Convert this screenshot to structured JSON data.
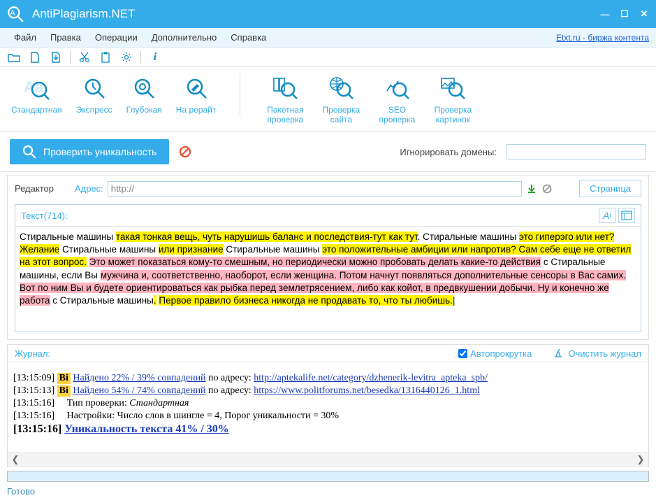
{
  "app": {
    "title": "AntiPlagiarism.NET"
  },
  "menu": {
    "items": [
      "Файл",
      "Правка",
      "Операции",
      "Дополнительно",
      "Справка"
    ],
    "right_link": "Etxt.ru - биржа контента"
  },
  "ribbon": {
    "left": [
      {
        "label": "Стандартная"
      },
      {
        "label": "Экспресс"
      },
      {
        "label": "Глубокая"
      },
      {
        "label": "На рерайт"
      }
    ],
    "right": [
      {
        "label": "Пакетная проверка"
      },
      {
        "label": "Проверка сайта"
      },
      {
        "label": "SEO проверка"
      },
      {
        "label": "Проверка картинок"
      }
    ]
  },
  "action": {
    "check_btn": "Проверить уникальность",
    "ignore_label": "Игнорировать домены:",
    "ignore_value": ""
  },
  "editor": {
    "label": "Редактор",
    "address_label": "Адрес:",
    "address_value": "http://",
    "page_tab": "Страница",
    "text_label": "Текст(714):",
    "segments": [
      {
        "text": "Стиральные машины ",
        "cls": ""
      },
      {
        "text": "такая тонкая вещь, чуть нарушишь баланс и последствия-тут как тут",
        "cls": "hl-y"
      },
      {
        "text": ". Стиральные машины ",
        "cls": ""
      },
      {
        "text": "это гиперэго или нет? Желание",
        "cls": "hl-y"
      },
      {
        "text": " Стиральные машины ",
        "cls": ""
      },
      {
        "text": "или признание",
        "cls": "hl-y"
      },
      {
        "text": " Стиральные машины ",
        "cls": ""
      },
      {
        "text": "это положительные амбиции или напротив? Сам себе еще не ответил на этот вопрос.",
        "cls": "hl-y"
      },
      {
        "text": " ",
        "cls": ""
      },
      {
        "text": "Это может показаться кому-то смешным, но периодически можно пробовать делать какие-то действия",
        "cls": "hl-p"
      },
      {
        "text": " с Стиральные машины, если Вы ",
        "cls": ""
      },
      {
        "text": "мужчина и, соответственно, наоборот, если женщина. Потом начнут появляться дополнительные сенсоры в Вас самих. Вот по ним Вы и будете ориентироваться как рыбка перед землетрясением, либо как койот, в предвкушении добычи. Ну и конечно же работа",
        "cls": "hl-p"
      },
      {
        "text": " с Стиральные машины",
        "cls": ""
      },
      {
        "text": ".",
        "cls": "hl-y"
      },
      {
        "text": " ",
        "cls": ""
      },
      {
        "text": "Первое правило бизнеса никогда не продавать то, что ты любишь.",
        "cls": "hl-y"
      }
    ]
  },
  "journal": {
    "label": "Журнал:",
    "autoscroll_label": "Автопрокрутка",
    "autoscroll_checked": true,
    "clear_label": "Очистить журнал",
    "lines": [
      {
        "ts": "[13:15:09]",
        "badge": "Bi",
        "found_link": "Найдено 22% / 39% совпадений",
        "sep": " по адресу: ",
        "url": "http://aptekalife.net/category/dzhenerik-levitra_apteka_spb/"
      },
      {
        "ts": "[13:15:13]",
        "badge": "Bi",
        "found_link": "Найдено 54% / 74% совпадений",
        "sep": " по адресу: ",
        "url": "https://www.politforums.net/besedka/1316440126_1.html"
      },
      {
        "ts": "[13:15:16]",
        "plain_before": "Тип проверки: ",
        "plain_em": "Стандартная"
      },
      {
        "ts": "[13:15:16]",
        "plain_before": "Настройки: Число слов в шингле = 4, Порог уникальности = 30%"
      },
      {
        "ts": "[13:15:16]",
        "result": "Уникальность текста 41% / 30%"
      }
    ]
  },
  "status": {
    "text": "Готово"
  }
}
